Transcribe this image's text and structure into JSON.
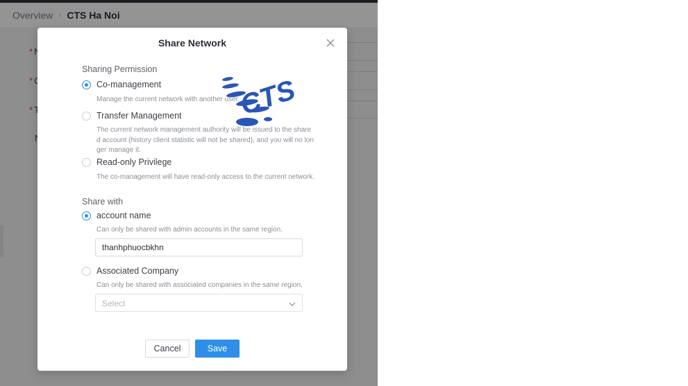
{
  "breadcrumb": {
    "parent": "Overview",
    "separator": "›",
    "current": "CTS Ha Noi"
  },
  "background_form": {
    "required_marker": "*",
    "row1_letter": "N",
    "row2_letter": "C",
    "row3_letter": "T",
    "row4_letter": "N"
  },
  "modal": {
    "title": "Share Network",
    "close_icon": "close-icon",
    "sharing_permission": {
      "label": "Sharing Permission",
      "options": [
        {
          "label": "Co-management",
          "description": "Manage the current network with another user.",
          "checked": true
        },
        {
          "label": "Transfer Management",
          "description_lines": [
            "The current network management authority will be issued to the share",
            "d account (history client statistic will not be shared), and you will no lon",
            "ger manage it."
          ],
          "checked": false
        },
        {
          "label": "Read-only Privilege",
          "description": "The co-management will have read-only access to the current network.",
          "checked": false
        }
      ]
    },
    "share_with": {
      "label": "Share with",
      "account": {
        "label": "account name",
        "description": "Can only be shared with admin accounts in the same region.",
        "value": "thanhphuocbkhn",
        "checked": true
      },
      "company": {
        "label": "Associated Company",
        "description": "Can only be shared with associated companies in the same region.",
        "placeholder": "Select",
        "checked": false
      }
    },
    "buttons": {
      "cancel": "Cancel",
      "save": "Save"
    }
  },
  "watermark": {
    "text": "CTS",
    "color": "#2a55b8"
  },
  "colors": {
    "accent": "#2f8fe8",
    "overlay": "rgba(0,0,0,0.42)",
    "topbar": "#2d3139"
  }
}
